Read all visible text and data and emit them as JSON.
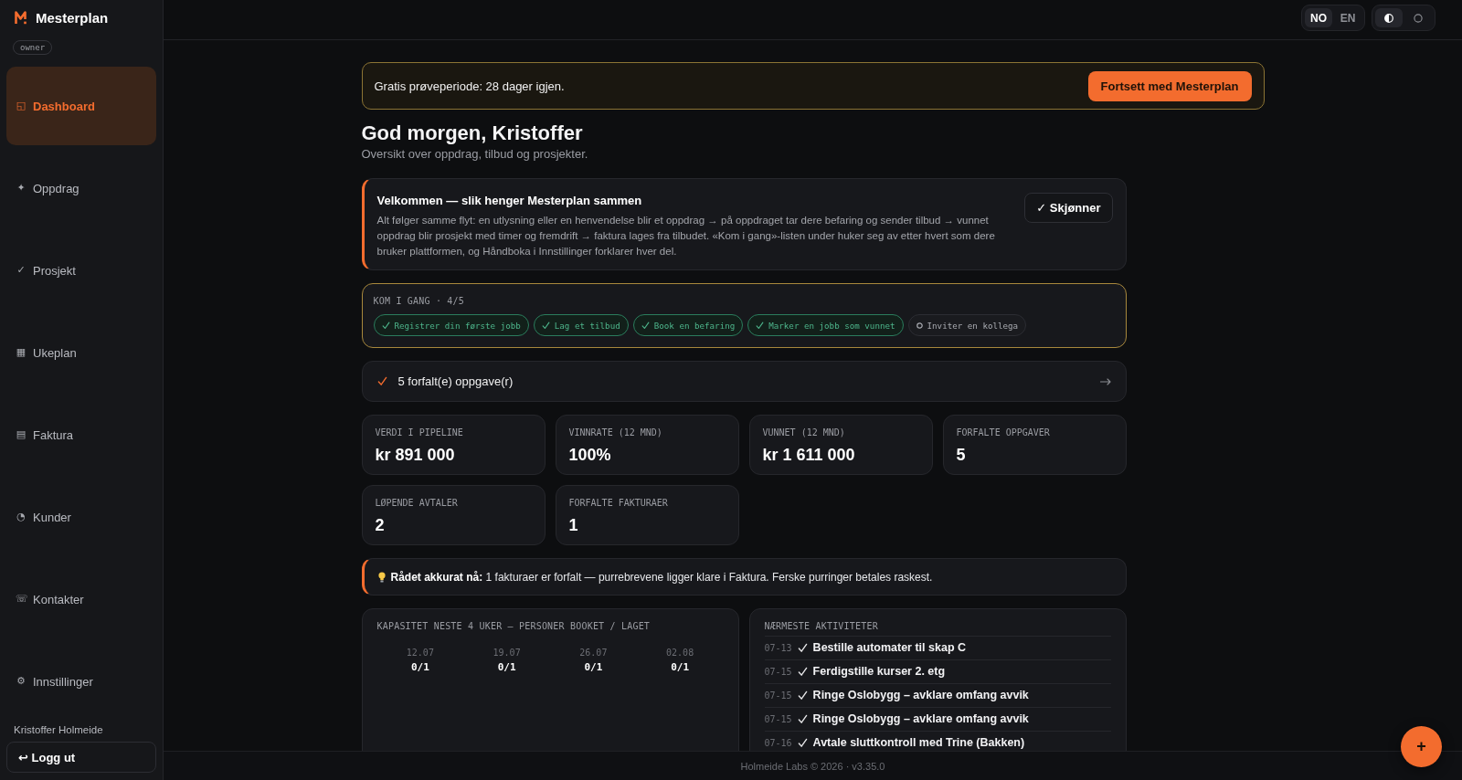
{
  "sidebar": {
    "brand": "Mesterplan",
    "role": "owner",
    "items": [
      {
        "icon": "◱",
        "label": "Dashboard",
        "selected": true
      },
      {
        "icon": "✦",
        "label": "Oppdrag",
        "selected": false
      },
      {
        "icon": "✓",
        "label": "Prosjekt",
        "selected": false
      },
      {
        "icon": "▦",
        "label": "Ukeplan",
        "selected": false
      },
      {
        "icon": "▤",
        "label": "Faktura",
        "selected": false
      },
      {
        "icon": "◔",
        "label": "Kunder",
        "selected": false
      },
      {
        "icon": "☏",
        "label": "Kontakter",
        "selected": false
      },
      {
        "icon": "⚙",
        "label": "Innstillinger",
        "selected": false
      }
    ],
    "user": "Kristoffer Holmeide",
    "logout": "↩ Logg ut"
  },
  "topbar": {
    "language": [
      {
        "label": "NO",
        "selected": true
      },
      {
        "label": "EN",
        "selected": false
      }
    ],
    "theme": [
      {
        "selected": true
      },
      {
        "selected": false
      }
    ]
  },
  "trial": {
    "text": "Gratis prøveperiode: 28 dager igjen.",
    "button": "Fortsett med Mesterplan"
  },
  "greeting": {
    "title": "God morgen, Kristoffer",
    "subtitle": "Oversikt over oppdrag, tilbud og prosjekter."
  },
  "welcome": {
    "title": "Velkommen — slik henger Mesterplan sammen",
    "body": "Alt følger samme flyt: en utlysning eller en henvendelse blir et oppdrag → på oppdraget tar dere befaring og sender tilbud → vunnet oppdrag blir prosjekt med timer og fremdrift → faktura lages fra tilbudet. «Kom i gang»-listen under huker seg av etter hvert som dere bruker plattformen, og Håndboka i Innstillinger forklarer hver del.",
    "button": "✓ Skjønner"
  },
  "getting_started": {
    "title": "KOM I GANG · 4/5",
    "steps": [
      {
        "label": "Registrer din første jobb",
        "done": true
      },
      {
        "label": "Lag et tilbud",
        "done": true
      },
      {
        "label": "Book en befaring",
        "done": true
      },
      {
        "label": "Marker en jobb som vunnet",
        "done": true
      },
      {
        "label": "Inviter en kollega",
        "done": false
      }
    ]
  },
  "overdue_tasks": {
    "label": "5 forfalt(e) oppgave(r)"
  },
  "stats": [
    {
      "label": "VERDI I PIPELINE",
      "value": "kr 891 000"
    },
    {
      "label": "VINNRATE (12 MND)",
      "value": "100%"
    },
    {
      "label": "VUNNET (12 MND)",
      "value": "kr 1 611 000"
    },
    {
      "label": "FORFALTE OPPGAVER",
      "value": "5"
    },
    {
      "label": "LØPENDE AVTALER",
      "value": "2"
    },
    {
      "label": "FORFALTE FAKTURAER",
      "value": "1"
    }
  ],
  "advice": {
    "text": "**Rådet akkurat nå:** 1 fakturaer er forfalt — purrebrevene ligger klare i Faktura. Ferske purringer betales raskest."
  },
  "capacity": {
    "title": "KAPASITET NESTE 4 UKER — PERSONER BOOKET / LAGET",
    "weeks": [
      {
        "date": "12.07",
        "value": "0/1"
      },
      {
        "date": "19.07",
        "value": "0/1"
      },
      {
        "date": "26.07",
        "value": "0/1"
      },
      {
        "date": "02.08",
        "value": "0/1"
      }
    ]
  },
  "activities": {
    "title": "NÆRMESTE AKTIVITETER",
    "items": [
      {
        "date": "07-13",
        "text": "Bestille automater til skap C"
      },
      {
        "date": "07-15",
        "text": "Ferdigstille kurser 2. etg"
      },
      {
        "date": "07-15",
        "text": "Ringe Oslobygg – avklare omfang avvik"
      },
      {
        "date": "07-15",
        "text": "Ringe Oslobygg – avklare omfang avvik"
      },
      {
        "date": "07-16",
        "text": "Avtale sluttkontroll med Trine (Bakken)"
      }
    ]
  },
  "footer": "Holmeide Labs © 2026 · v3.35.0",
  "fab": "+"
}
